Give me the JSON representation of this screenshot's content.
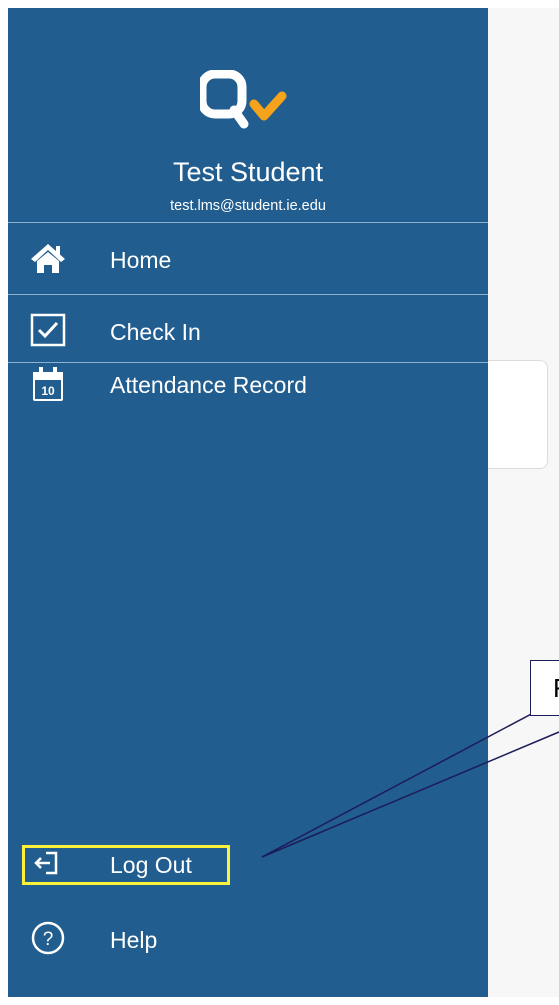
{
  "user": {
    "name": "Test Student",
    "email": "test.lms@student.ie.edu"
  },
  "nav": {
    "home": {
      "label": "Home",
      "icon": "home-icon"
    },
    "check_in": {
      "label": "Check In",
      "icon": "checkbox-icon"
    },
    "attendance": {
      "label": "Attendance Record",
      "icon": "calendar-icon",
      "icon_text": "10"
    }
  },
  "footer": {
    "logout": {
      "label": "Log Out",
      "icon": "logout-icon"
    },
    "help": {
      "label": "Help",
      "icon": "help-icon",
      "icon_text": "?"
    }
  },
  "annotation": {
    "callout_text": "F",
    "highlight_color": "#fcf03a",
    "line_color": "#1c1c5a"
  },
  "colors": {
    "drawer": "#215d8f",
    "logo_white": "#ffffff",
    "logo_orange": "#f5a31a",
    "text": "#ffffff"
  }
}
